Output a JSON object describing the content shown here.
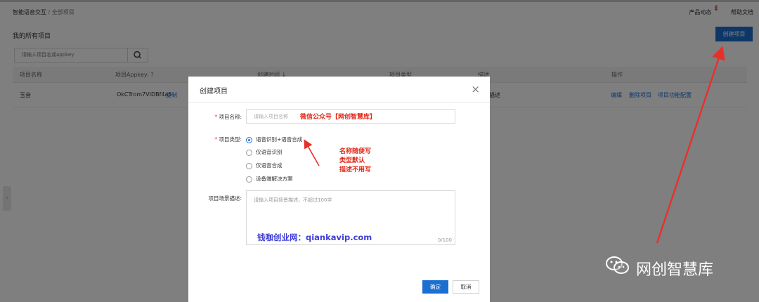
{
  "breadcrumb": {
    "root": "智能语音交互",
    "sep": "/",
    "current": "全部项目"
  },
  "header": {
    "news": "产品动态",
    "news_badge": "5",
    "docs": "帮助文档"
  },
  "page": {
    "title": "我的所有项目",
    "create_button": "创建项目"
  },
  "search": {
    "placeholder": "请输入项目名或appkey"
  },
  "table": {
    "columns": [
      "项目名称",
      "项目Appkey: ?",
      "创建时间 ↓",
      "项目类型",
      "描述",
      "操作"
    ],
    "row": {
      "name": "玉音",
      "appkey": "OkCTrom7VIDBf4a5",
      "copy": "复制",
      "desc": "描述",
      "actions": [
        "编辑",
        "删除项目",
        "项目功能配置"
      ]
    }
  },
  "modal": {
    "title": "创建项目",
    "close": "×",
    "name_label": "项目名称:",
    "name_placeholder": "请输入项目名称",
    "name_value": "微信公众号【网创智慧库】",
    "type_label": "项目类型:",
    "types": [
      "语音识别+语音合成",
      "仅语音识别",
      "仅语音合成",
      "设备端解决方案"
    ],
    "selected_type_index": 0,
    "desc_label": "项目场景描述:",
    "desc_placeholder": "请输入项目场景描述，不超过100字",
    "desc_counter": "0/100",
    "ok": "确定",
    "cancel": "取消"
  },
  "annotations": {
    "note_lines": [
      "名称随便写",
      "类型默认",
      "描述不用写"
    ],
    "site_watermark": "钱咖创业网：qiankavip.com",
    "account_watermark": "网创智慧库"
  },
  "colors": {
    "primary": "#1c6fd1",
    "annotation_red": "#e12a1a",
    "watermark_blue": "#3e3ed8"
  },
  "icons": {
    "search": "search-icon",
    "close": "close-icon",
    "help": "help-icon",
    "wechat": "wechat-icon"
  }
}
